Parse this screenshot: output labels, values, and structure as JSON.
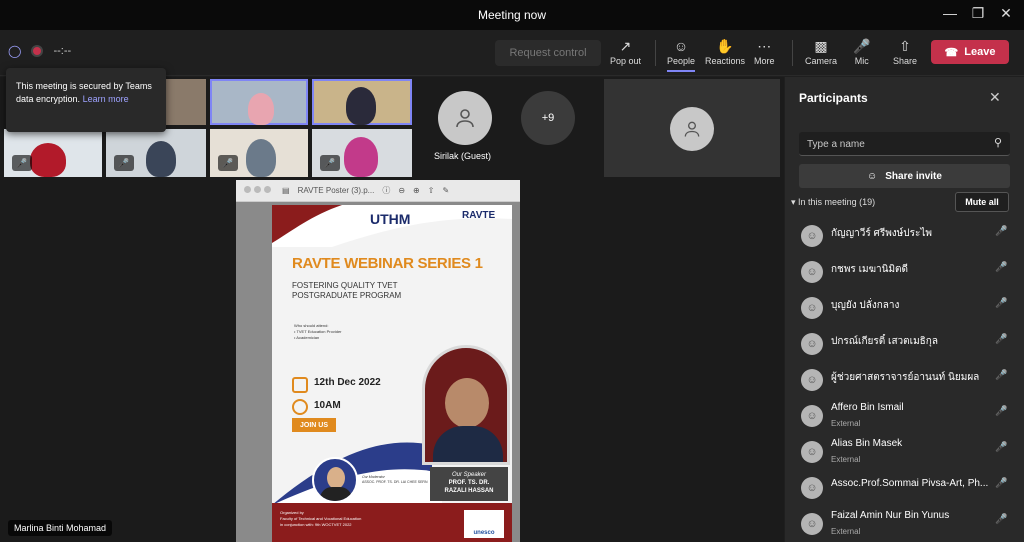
{
  "window": {
    "title": "Meeting now"
  },
  "toolbar": {
    "timer": "--:--",
    "request_control": "Request control",
    "pop_out": "Pop out",
    "people": "People",
    "reactions": "Reactions",
    "more": "More",
    "camera": "Camera",
    "mic": "Mic",
    "share": "Share",
    "leave": "Leave",
    "leave_color": "#c4314b",
    "accent": "#7f85f5"
  },
  "tooltip": {
    "text": "This meeting is secured by Teams data encryption.",
    "link": "Learn more"
  },
  "stage": {
    "guest_name": "Sirilak (Guest)",
    "overflow_count": "+9",
    "presenter_name": "Marlina Binti Mohamad",
    "pdf_title": "RAVTE Poster (3).p..."
  },
  "poster": {
    "uthm": "UTHM",
    "ravte": "RAVTE",
    "title": "RAVTE WEBINAR SERIES 1",
    "subtitle_line1": "FOSTERING QUALITY TVET",
    "subtitle_line2": "POSTGRADUATE PROGRAM",
    "who": "Who should attend:",
    "who1": "• TVET Education Provider",
    "who2": "• Academician",
    "date": "12th Dec 2022",
    "time": "10AM",
    "join": "JOIN US",
    "speaker_role": "Our Speaker",
    "speaker_name1": "PROF. TS. DR.",
    "speaker_name2": "RAZALI HASSAN",
    "moderator_role": "Our Moderator",
    "moderator_name": "ASSOC. PROF. TS. DR. LAI CHEE SERN",
    "org1": "Organized by",
    "org2": "Faculty of Technical and Vocational Education",
    "org3": "in conjunction with: 9th WOCTVET 2022",
    "unesco": "unesco"
  },
  "panel": {
    "title": "Participants",
    "search_placeholder": "Type a name",
    "share_invite": "Share invite",
    "in_meeting": "In this meeting (19)",
    "mute_all": "Mute all",
    "participants": [
      {
        "name": "กัญญาวีร์ ศรีพงษ์ประไพ",
        "sub": "",
        "mic": "muted"
      },
      {
        "name": "กชพร เมฆานิมิตดี",
        "sub": "",
        "mic": "muted"
      },
      {
        "name": "บุญยัง ปลั่งกลาง",
        "sub": "",
        "mic": "muted"
      },
      {
        "name": "ปกรณ์เกียรติ์ เสวตเมธิกุล",
        "sub": "",
        "mic": "on"
      },
      {
        "name": "ผู้ช่วยศาสตราจารย์อานนท์ นิยมผล",
        "sub": "",
        "mic": "muted"
      },
      {
        "name": "Affero Bin Ismail",
        "sub": "External",
        "mic": "muted"
      },
      {
        "name": "Alias Bin Masek",
        "sub": "External",
        "mic": "muted"
      },
      {
        "name": "Assoc.Prof.Sommai Pivsa-Art, Ph...",
        "sub": "",
        "mic": "muted"
      },
      {
        "name": "Faizal Amin Nur Bin Yunus",
        "sub": "External",
        "mic": "muted"
      }
    ]
  }
}
